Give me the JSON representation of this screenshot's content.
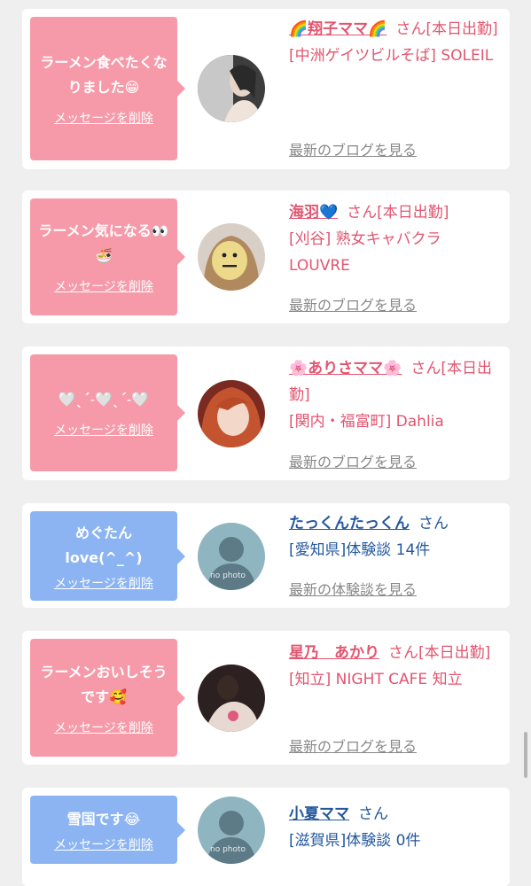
{
  "entries": [
    {
      "message": "ラーメン食べたくなりました😁",
      "delete_label": "メッセージを削除",
      "name": "🌈翔子ママ🌈",
      "honorific": "さん",
      "status": "[本日出勤]",
      "shop": "[中洲ゲイツビルそば] SOLEIL",
      "link_label": "最新のブログを見る"
    },
    {
      "message": "ラーメン気になる👀🍜",
      "delete_label": "メッセージを削除",
      "name": "海羽💙",
      "honorific": "さん",
      "status": "[本日出勤]",
      "shop": "[刈谷] 熟女キャバクラLOUVRE",
      "link_label": "最新のブログを見る"
    },
    {
      "message": "🤍ˎˊ˗🤍ˎˊ˗🤍",
      "delete_label": "メッセージを削除",
      "name": "🌸ありさママ🌸",
      "honorific": "さん",
      "status": "[本日出勤]",
      "shop": "[関内・福富町] Dahlia",
      "link_label": "最新のブログを見る"
    },
    {
      "message": "めぐたん love(^_^)",
      "delete_label": "メッセージを削除",
      "name": "たっくんたっくん",
      "honorific": "さん",
      "status": "",
      "shop": "[愛知県]体験談 14件",
      "link_label": "最新の体験談を見る",
      "photo_caption": "no photo"
    },
    {
      "message": "ラーメンおいしそうです🥰",
      "delete_label": "メッセージを削除",
      "name": "星乃　あかり",
      "honorific": "さん",
      "status": "[本日出勤]",
      "shop": "[知立] NIGHT CAFE 知立",
      "link_label": "最新のブログを見る"
    },
    {
      "message": "雪国です😂",
      "delete_label": "メッセージを削除",
      "name": "小夏ママ",
      "honorific": "さん",
      "status": "",
      "shop": "[滋賀県]体験談 0件",
      "link_label": "",
      "photo_caption": "no photo"
    }
  ],
  "colors": {
    "pink_bubble": "#f69aa9",
    "blue_bubble": "#8cb4f2",
    "pink_text": "#e2556f",
    "blue_text": "#23589c"
  }
}
